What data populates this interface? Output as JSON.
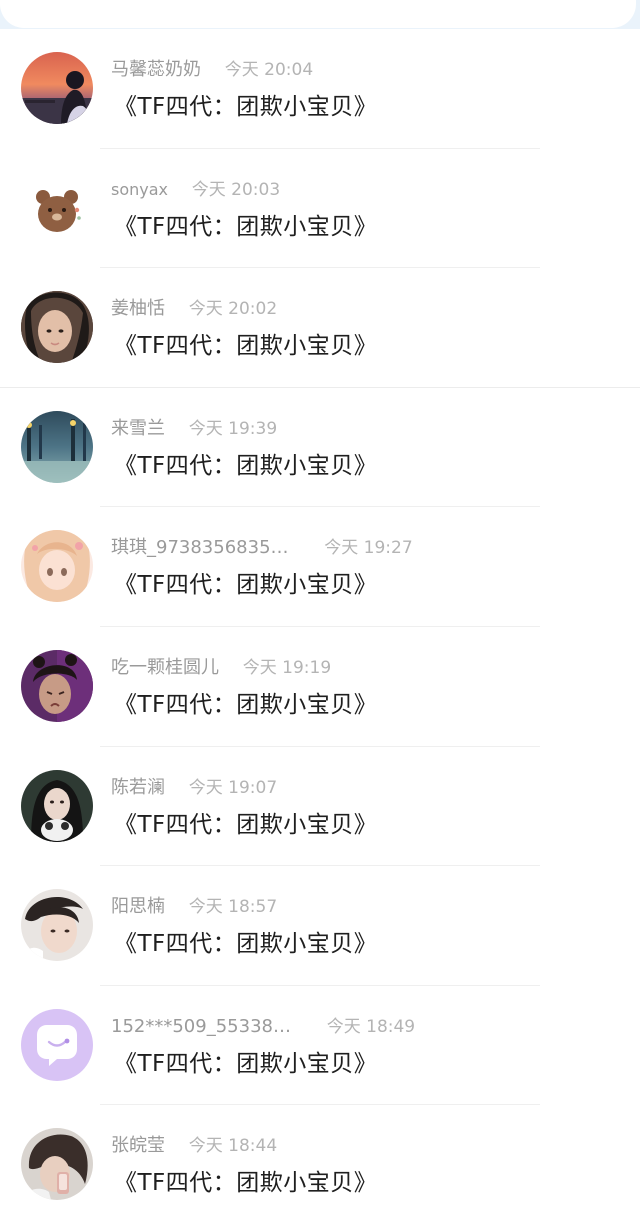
{
  "header": {
    "back_icon": "chevron-left-icon",
    "accent": "#3b8ef0"
  },
  "messages": [
    {
      "name": "马馨蕊奶奶",
      "time": "今天 20:04",
      "text": "《TF四代：团欺小宝贝》",
      "avatar": "photo-avatar"
    },
    {
      "name": "sonyax",
      "time": "今天 20:03",
      "text": "《TF四代：团欺小宝贝》",
      "avatar": "bear-avatar"
    },
    {
      "name": "姜柚恬",
      "time": "今天 20:02",
      "text": "《TF四代：团欺小宝贝》",
      "avatar": "photo-avatar"
    },
    {
      "name": "来雪兰",
      "time": "今天 19:39",
      "text": "《TF四代：团欺小宝贝》",
      "avatar": "photo-avatar"
    },
    {
      "name": "琪琪_9738356835…",
      "time": "今天 19:27",
      "text": "《TF四代：团欺小宝贝》",
      "avatar": "anime-avatar"
    },
    {
      "name": "吃一颗桂圆儿",
      "time": "今天 19:19",
      "text": "《TF四代：团欺小宝贝》",
      "avatar": "photo-avatar"
    },
    {
      "name": "陈若澜",
      "time": "今天 19:07",
      "text": "《TF四代：团欺小宝贝》",
      "avatar": "photo-avatar"
    },
    {
      "name": "阳思楠",
      "time": "今天 18:57",
      "text": "《TF四代：团欺小宝贝》",
      "avatar": "photo-avatar"
    },
    {
      "name": "152***509_55338…",
      "time": "今天 18:49",
      "text": "《TF四代：团欺小宝贝》",
      "avatar": "chat-bubble-avatar"
    },
    {
      "name": "张皖莹",
      "time": "今天 18:44",
      "text": "《TF四代：团欺小宝贝》",
      "avatar": "photo-avatar"
    }
  ]
}
